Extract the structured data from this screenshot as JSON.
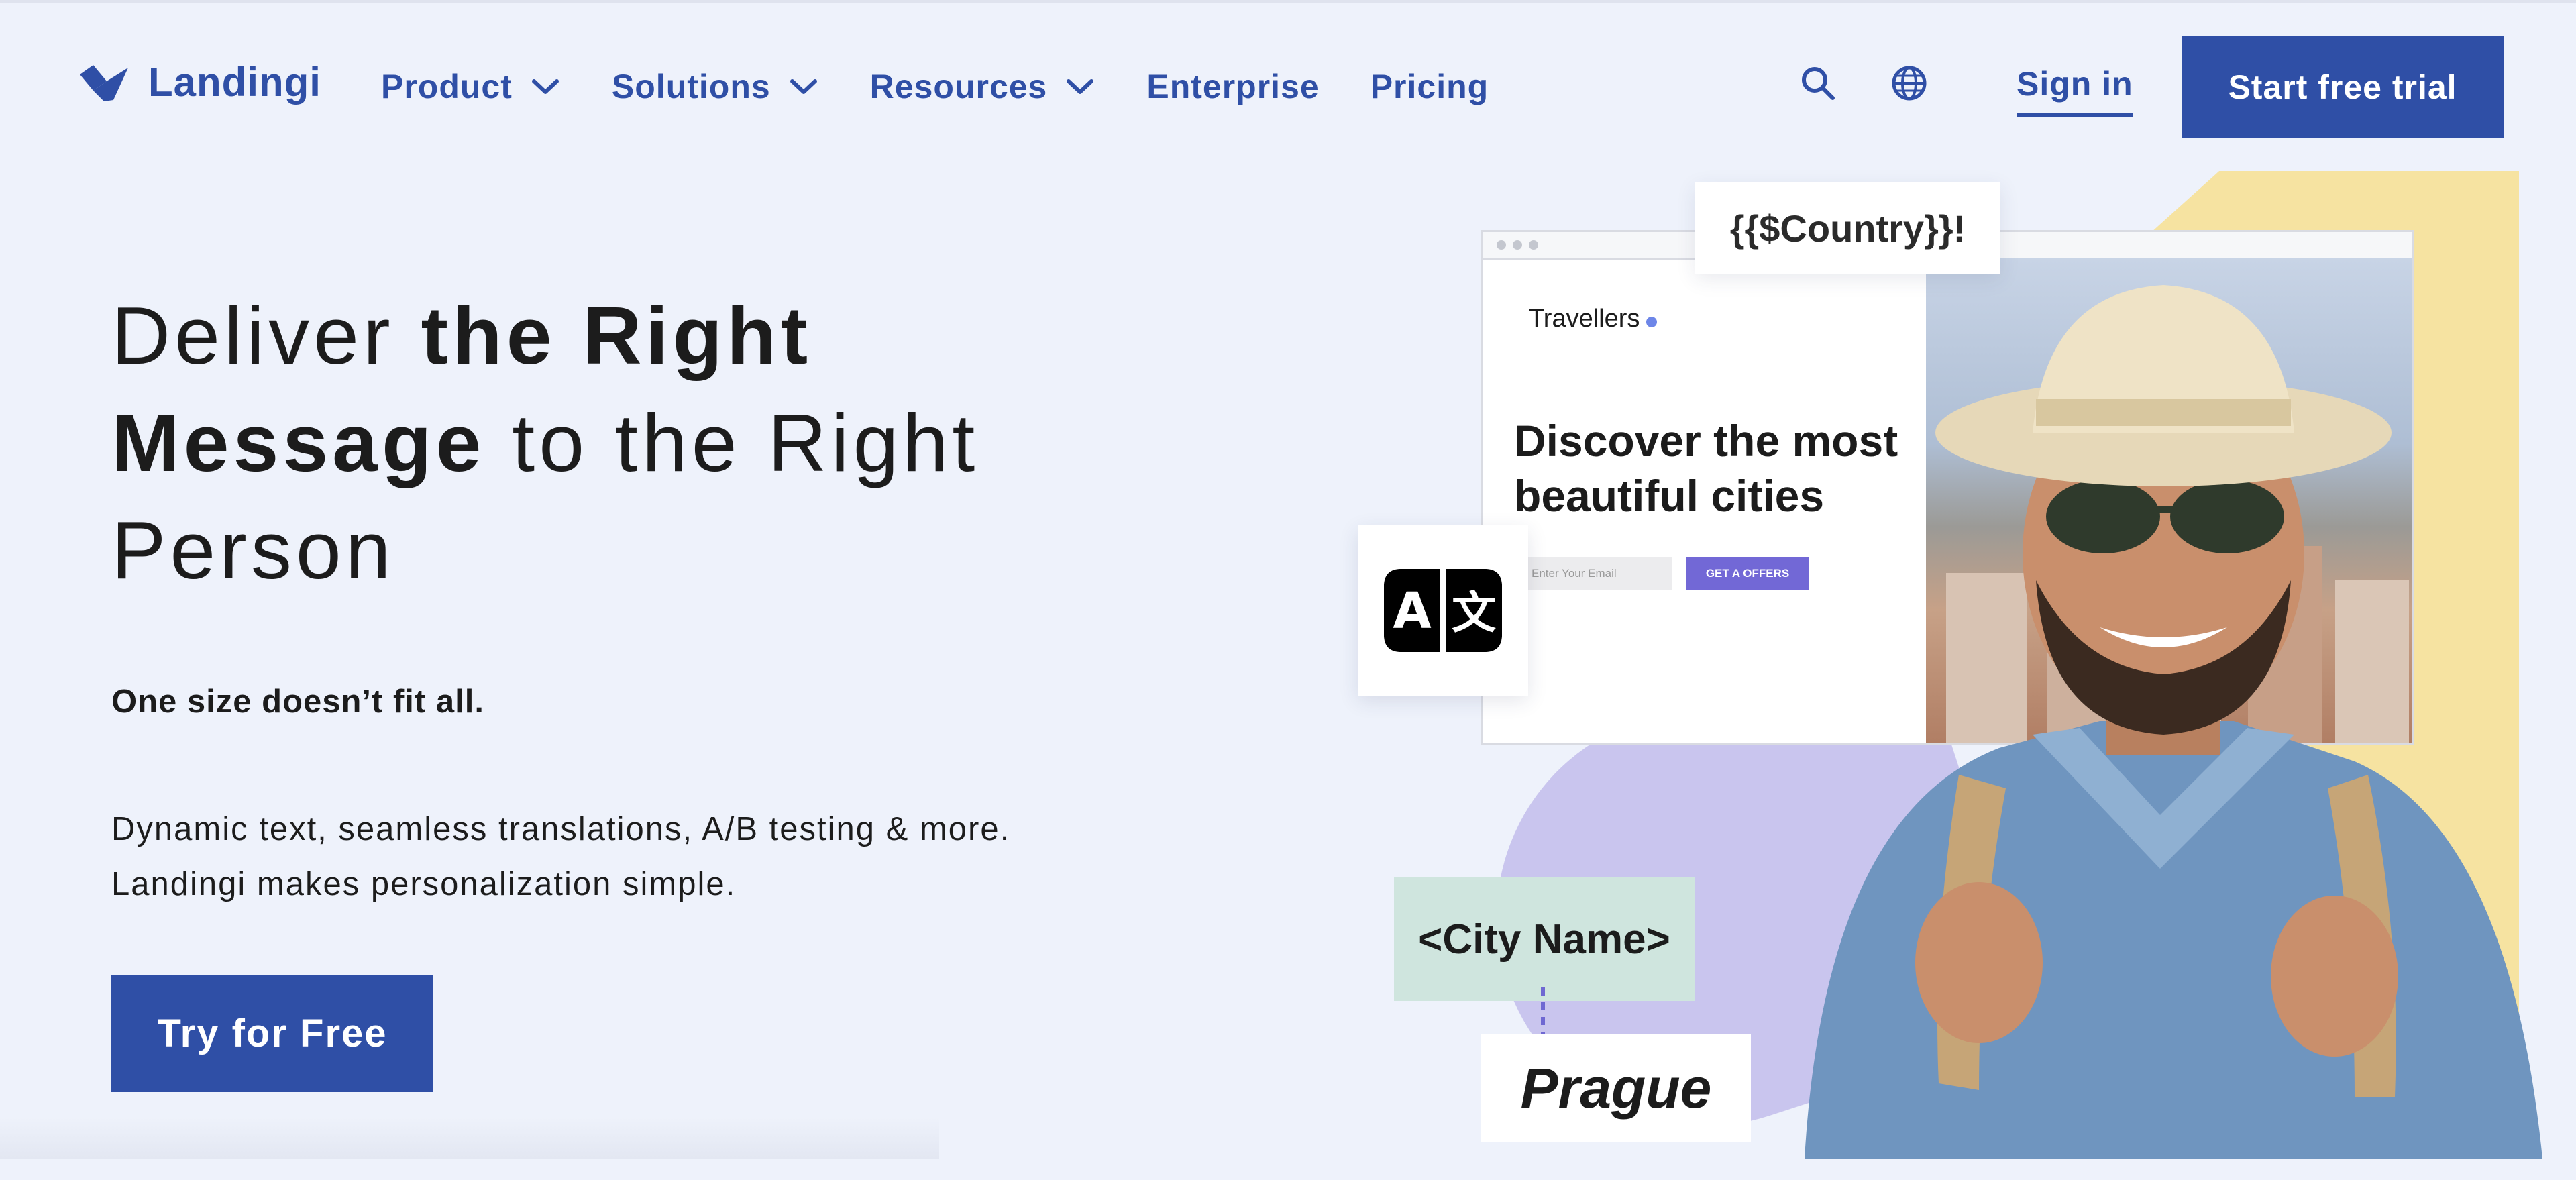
{
  "nav": {
    "logo_text": "Landingi",
    "items": [
      {
        "label": "Product",
        "dropdown": true
      },
      {
        "label": "Solutions",
        "dropdown": true
      },
      {
        "label": "Resources",
        "dropdown": true
      },
      {
        "label": "Enterprise",
        "dropdown": false
      },
      {
        "label": "Pricing",
        "dropdown": false
      }
    ],
    "search_icon": "search-icon",
    "globe_icon": "globe-icon",
    "sign_in": "Sign in",
    "start_trial": "Start free trial"
  },
  "hero": {
    "headline_p1": "Deliver ",
    "headline_b1": "the Right Message",
    "headline_p2": " to the Right Person",
    "tagline": "One size doesn’t fit all.",
    "description_line1": "Dynamic text, seamless translations, A/B testing & more.",
    "description_line2": "Landingi makes personalization simple.",
    "cta": "Try for Free"
  },
  "visual": {
    "country_tag": "{{$Country}}!",
    "mock_brand": "Travellers",
    "mock_headline": "Discover the most beautiful cities",
    "mock_input_placeholder": "Enter Your Email",
    "mock_button": "GET A OFFERS",
    "translate_icon": "translate-icon",
    "city_tag": "<City Name>",
    "city_result": "Prague"
  },
  "colors": {
    "brand_blue": "#2f4fa6",
    "background": "#eef2fb",
    "yellow_accent": "#f6e3a1",
    "purple_accent": "#c9c5ee",
    "mint_tag": "#cfe5de",
    "mock_button": "#7268d6"
  }
}
